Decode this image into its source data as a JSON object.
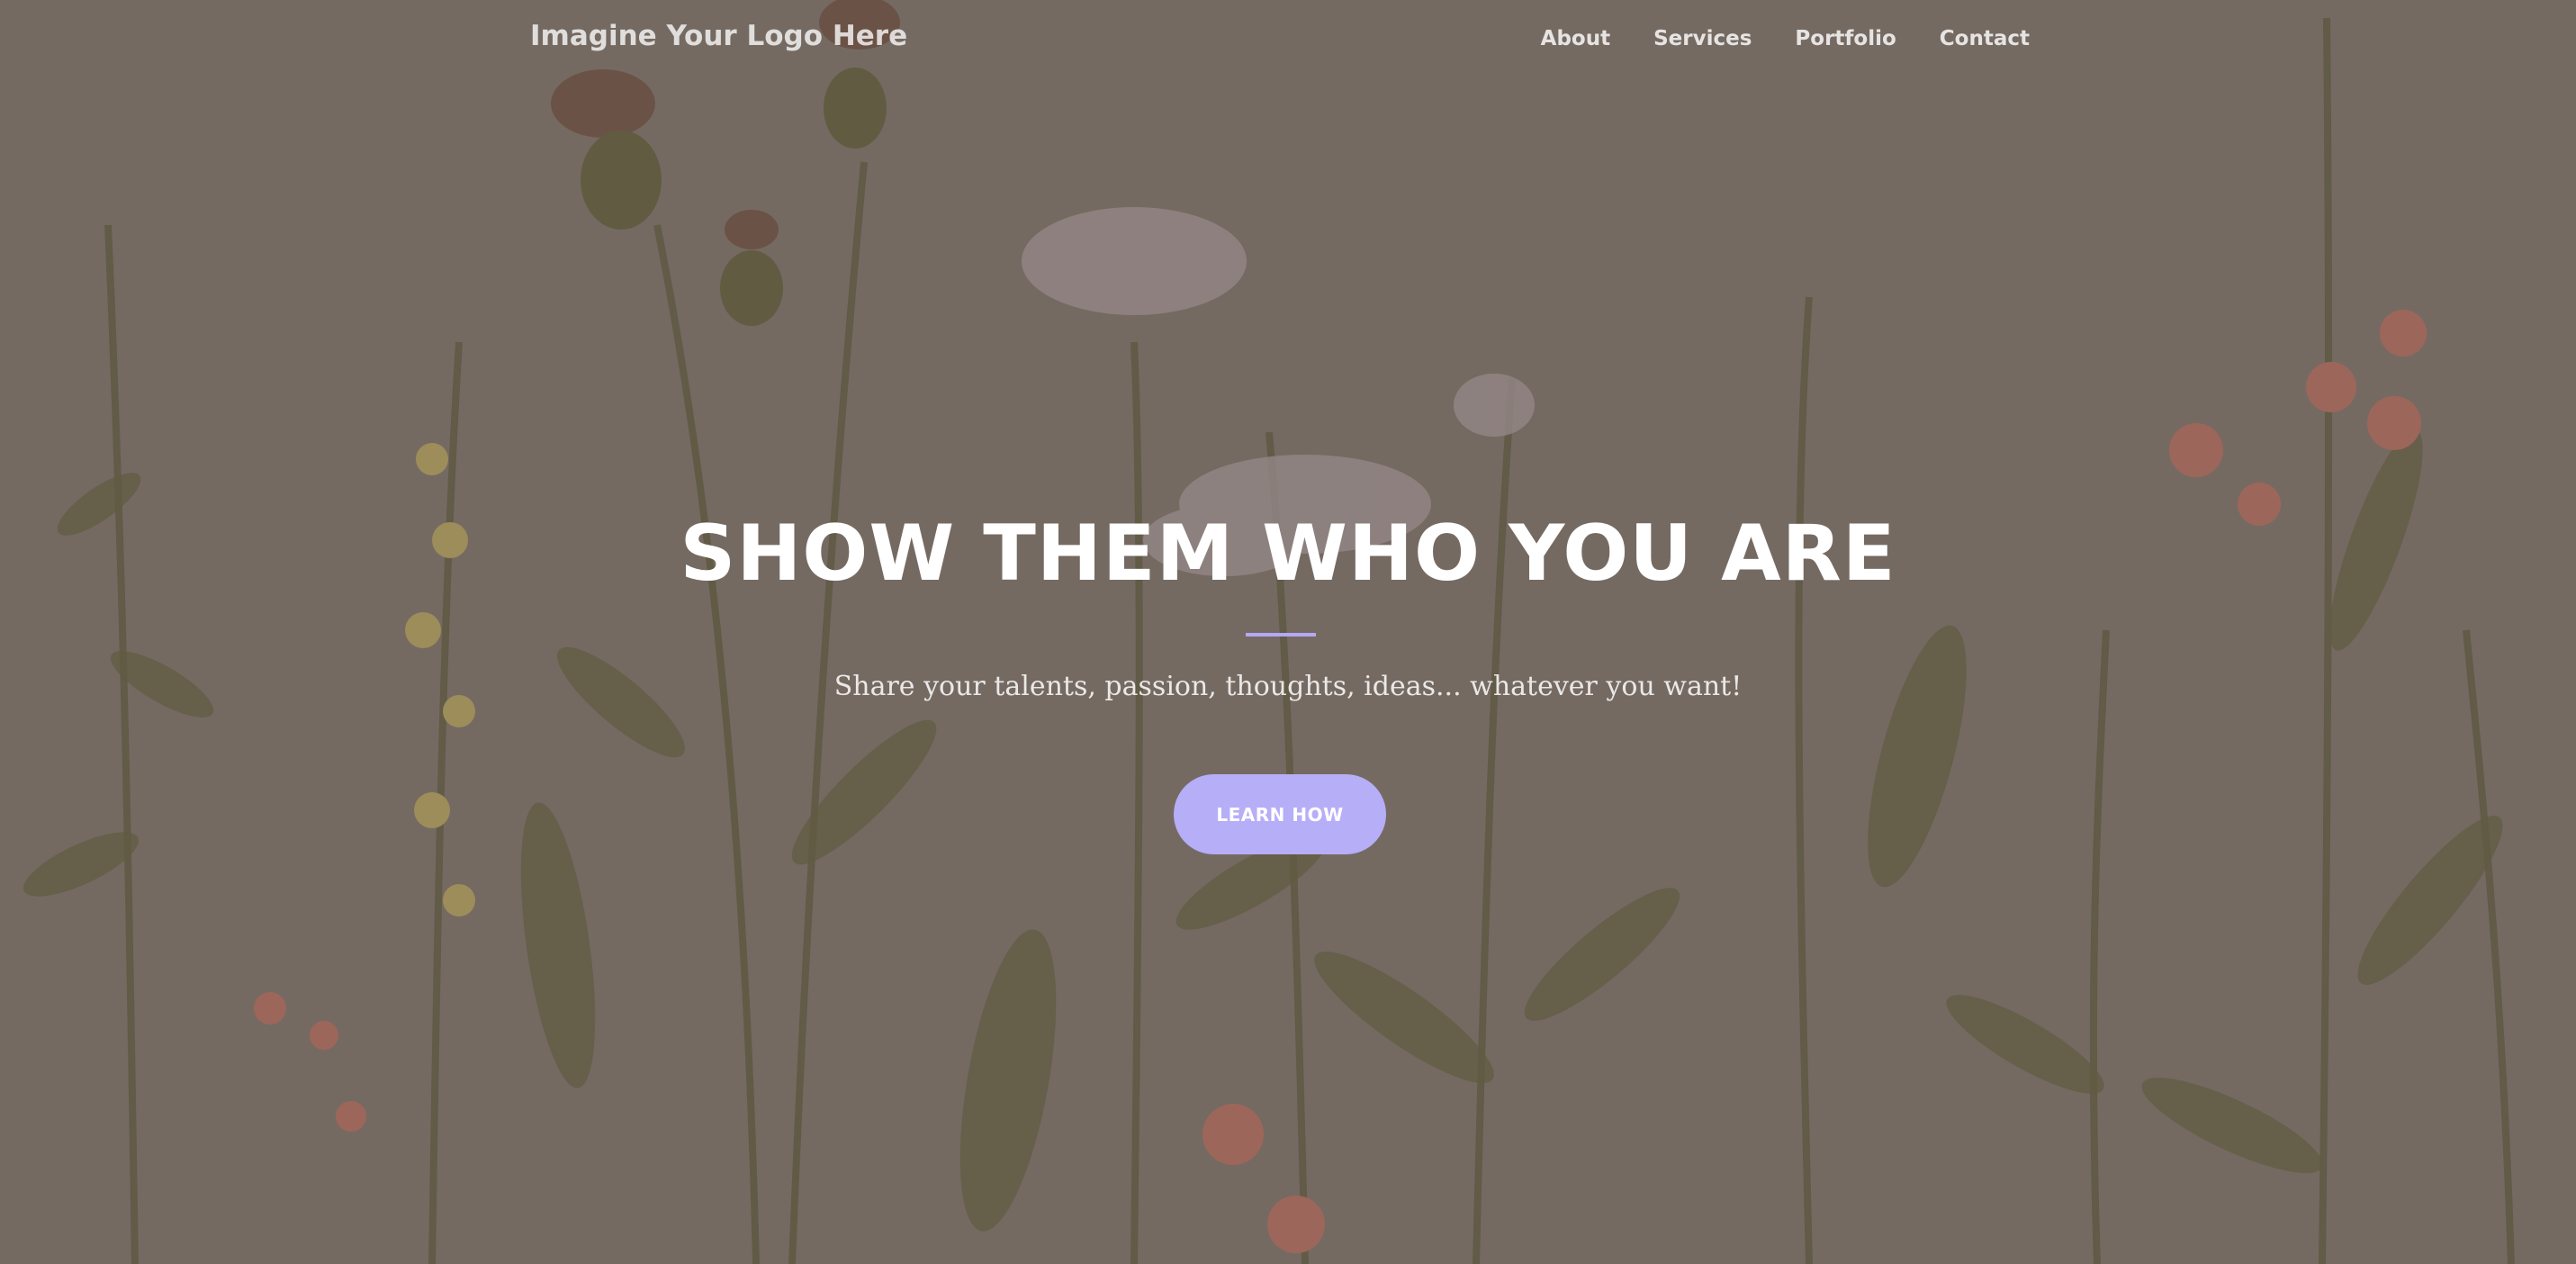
{
  "brand": {
    "logo_text": "Imagine Your Logo Here"
  },
  "nav": {
    "items": [
      {
        "label": "About"
      },
      {
        "label": "Services"
      },
      {
        "label": "Portfolio"
      },
      {
        "label": "Contact"
      }
    ]
  },
  "hero": {
    "title": "SHOW THEM WHO YOU ARE",
    "subtitle": "Share your talents, passion, thoughts, ideas... whatever you want!",
    "cta_label": "LEARN HOW",
    "background_image": "wildflowers-botanical-illustration"
  },
  "colors": {
    "background": "#776c63",
    "accent": "#b7aef8",
    "divider": "#b4a8f7",
    "foliage": "#5e5a3c",
    "flower_red": "#b0695a",
    "flower_yellow": "#b5a35a",
    "flower_pale": "#b8adb0"
  }
}
